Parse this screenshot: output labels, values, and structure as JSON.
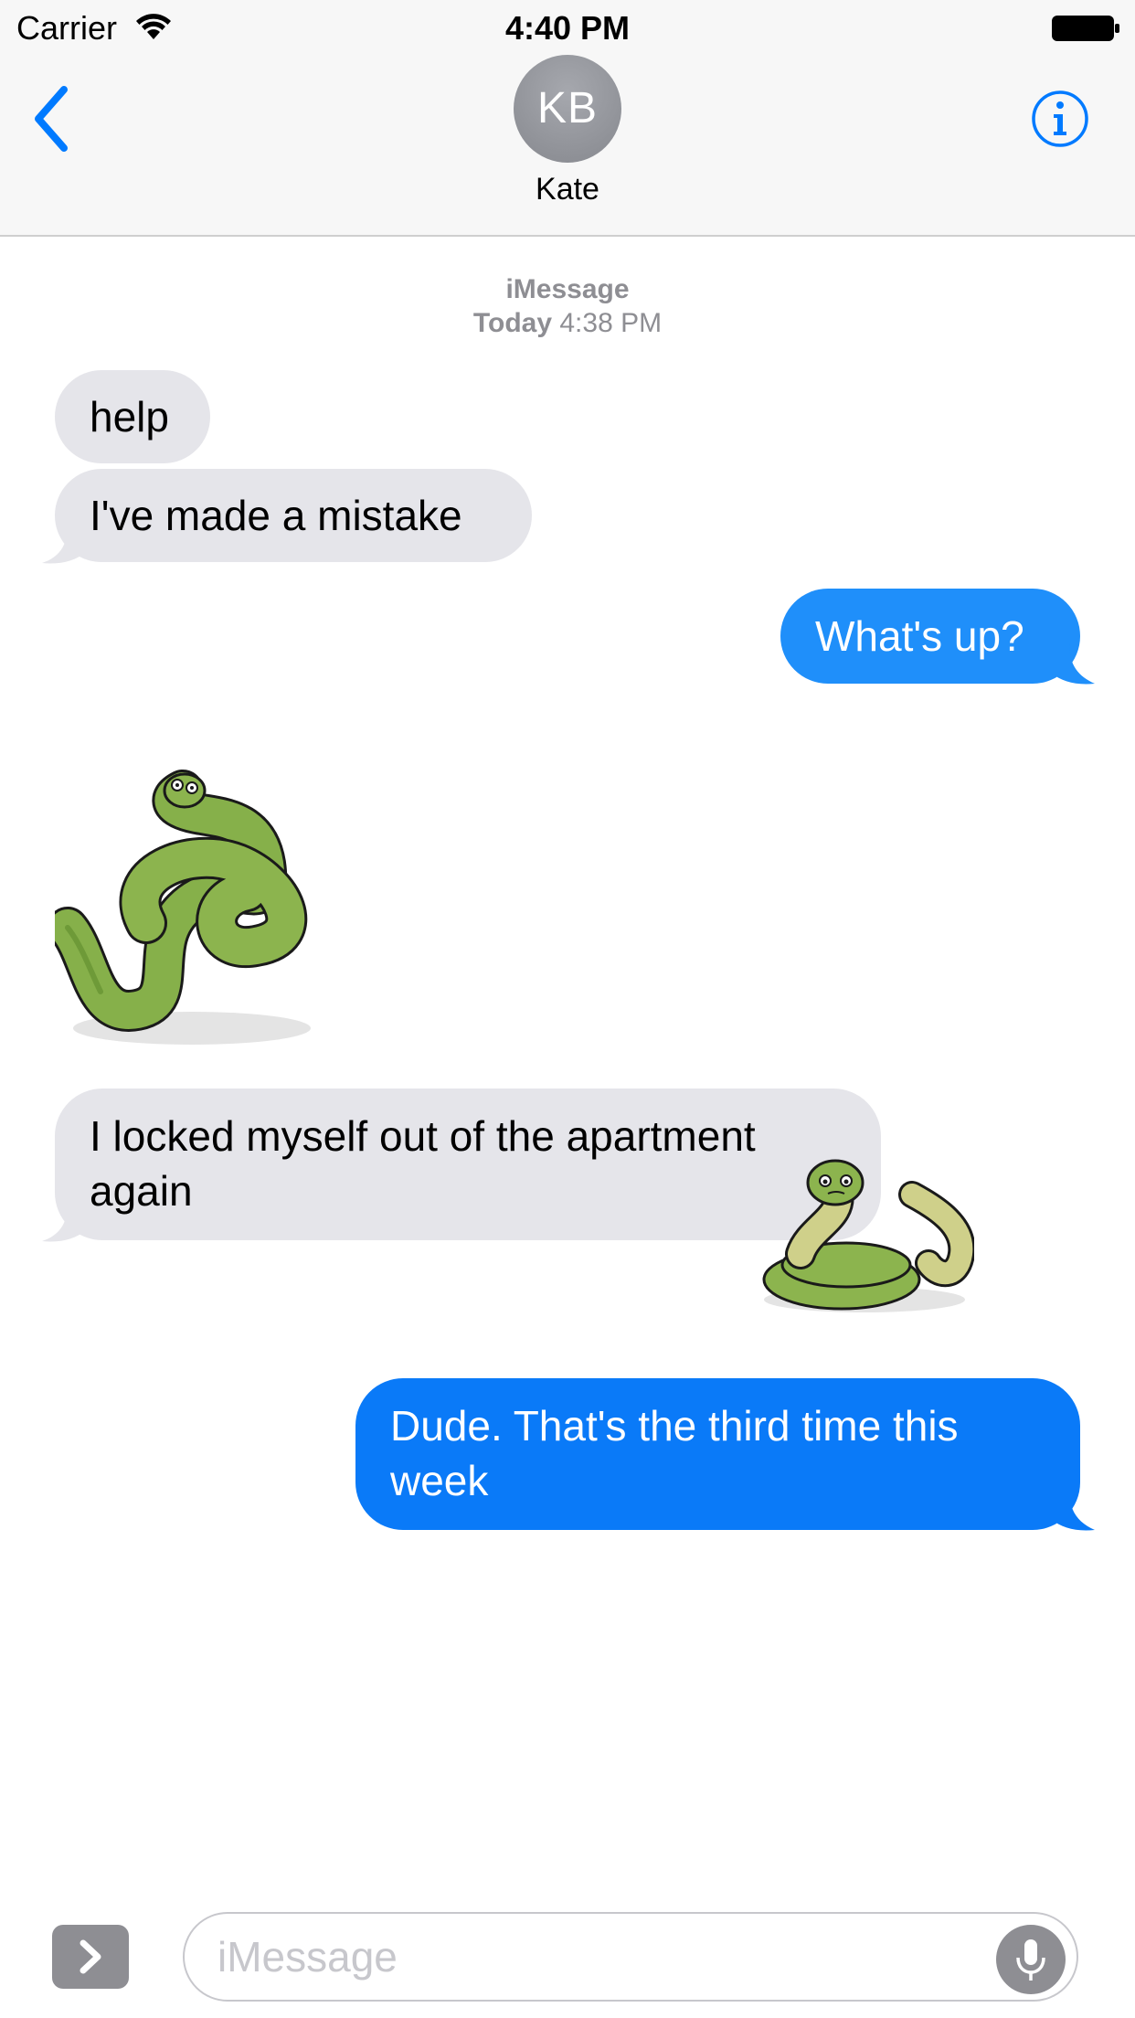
{
  "status_bar": {
    "carrier": "Carrier",
    "time": "4:40 PM",
    "wifi_icon": "wifi-icon",
    "battery_icon": "battery-icon"
  },
  "nav": {
    "back_icon": "chevron-left-icon",
    "avatar_initials": "KB",
    "contact_name": "Kate",
    "info_icon": "info-icon",
    "accent_color": "#007aff"
  },
  "conversation": {
    "service": "iMessage",
    "timestamp_day": "Today",
    "timestamp_time": "4:38 PM",
    "messages": [
      {
        "direction": "incoming",
        "text": "help"
      },
      {
        "direction": "incoming",
        "text": "I've made a mistake"
      },
      {
        "direction": "outgoing",
        "text": "What's up?"
      },
      {
        "direction": "incoming",
        "type": "sticker",
        "sticker": "tangled-snake-sticker"
      },
      {
        "direction": "incoming",
        "lines": [
          "I locked myself out of the apartment",
          "again"
        ]
      },
      {
        "direction": "incoming",
        "type": "sticker",
        "sticker": "coiled-snake-sticker"
      },
      {
        "direction": "outgoing",
        "lines": [
          "Dude. That's the third time this",
          "week"
        ]
      }
    ],
    "incoming_color": "#e5e5ea",
    "outgoing_color": "#1f8ffa",
    "outgoing_latest_color": "#0a7af8"
  },
  "input_bar": {
    "apps_icon": "chevron-right-icon",
    "placeholder": "iMessage",
    "mic_icon": "microphone-icon"
  }
}
